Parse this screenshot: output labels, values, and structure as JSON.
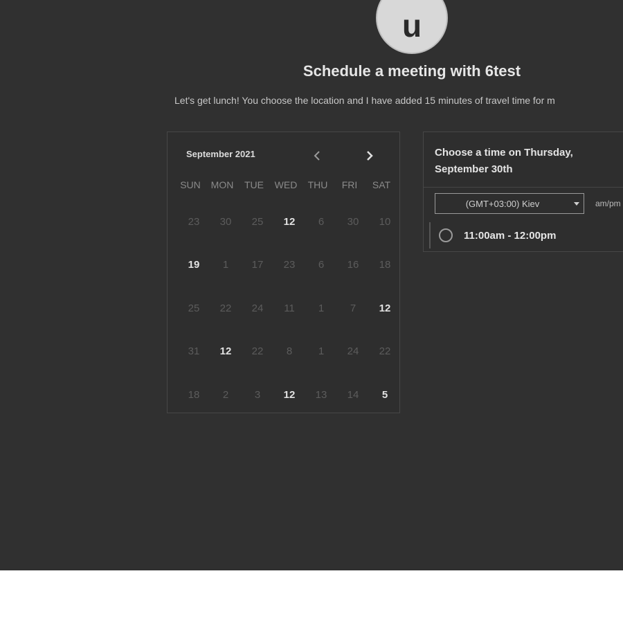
{
  "avatar": {
    "initial": "u"
  },
  "header": {
    "title": "Schedule a meeting with 6test",
    "subtitle": "Let's get lunch! You choose the location and I have added 15 minutes of travel time for m"
  },
  "calendar": {
    "month_label": "September 2021",
    "prev_icon": "chevron-left-icon",
    "next_icon": "chevron-right-icon",
    "weekdays": [
      "SUN",
      "MON",
      "TUE",
      "WED",
      "THU",
      "FRI",
      "SAT"
    ],
    "weeks": [
      [
        "23",
        "30",
        "25",
        "12",
        "6",
        "30",
        "10"
      ],
      [
        "19",
        "1",
        "17",
        "23",
        "6",
        "16",
        "18"
      ],
      [
        "25",
        "22",
        "24",
        "11",
        "1",
        "7",
        "12"
      ],
      [
        "31",
        "12",
        "22",
        "8",
        "1",
        "24",
        "22"
      ],
      [
        "18",
        "2",
        "3",
        "12",
        "13",
        "14",
        "5"
      ]
    ],
    "available": [
      [
        0,
        3
      ],
      [
        1,
        0
      ],
      [
        2,
        6
      ],
      [
        3,
        1
      ],
      [
        4,
        3
      ],
      [
        4,
        6
      ]
    ]
  },
  "times": {
    "title": "Choose a time on Thursday, September 30th",
    "timezone": "(GMT+03:00) Kiev",
    "format_label": "am/pm",
    "slots": [
      "11:00am - 12:00pm"
    ]
  },
  "colors": {
    "background": "#303030",
    "panel": "#2e2e2e",
    "text_primary": "#e6e6e6",
    "text_muted": "#5c5c5c"
  }
}
